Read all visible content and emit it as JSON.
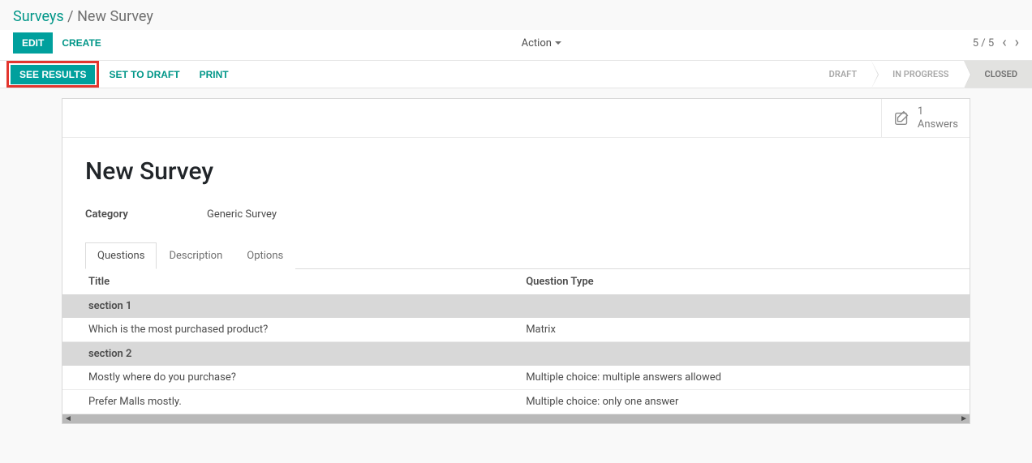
{
  "breadcrumb": {
    "root": "Surveys",
    "sep": " / ",
    "current": "New Survey"
  },
  "toolbar": {
    "edit": "EDIT",
    "create": "CREATE",
    "action": "Action"
  },
  "pager": {
    "position": "5 / 5"
  },
  "statusbar": {
    "see_results": "SEE RESULTS",
    "set_to_draft": "SET TO DRAFT",
    "print": "PRINT",
    "stages": {
      "draft": "DRAFT",
      "in_progress": "IN PROGRESS",
      "closed": "CLOSED"
    }
  },
  "stat": {
    "count": "1",
    "label": "Answers"
  },
  "record": {
    "title": "New Survey",
    "category_label": "Category",
    "category_value": "Generic Survey"
  },
  "tabs": {
    "questions": "Questions",
    "description": "Description",
    "options": "Options"
  },
  "table": {
    "headers": {
      "title": "Title",
      "type": "Question Type"
    },
    "rows": [
      {
        "kind": "section",
        "title": "section 1",
        "type": ""
      },
      {
        "kind": "question",
        "title": "Which is the most purchased product?",
        "type": "Matrix"
      },
      {
        "kind": "section",
        "title": "section 2",
        "type": ""
      },
      {
        "kind": "question",
        "title": "Mostly where do you purchase?",
        "type": "Multiple choice: multiple answers allowed"
      },
      {
        "kind": "question",
        "title": "Prefer Malls mostly.",
        "type": "Multiple choice: only one answer"
      }
    ]
  }
}
